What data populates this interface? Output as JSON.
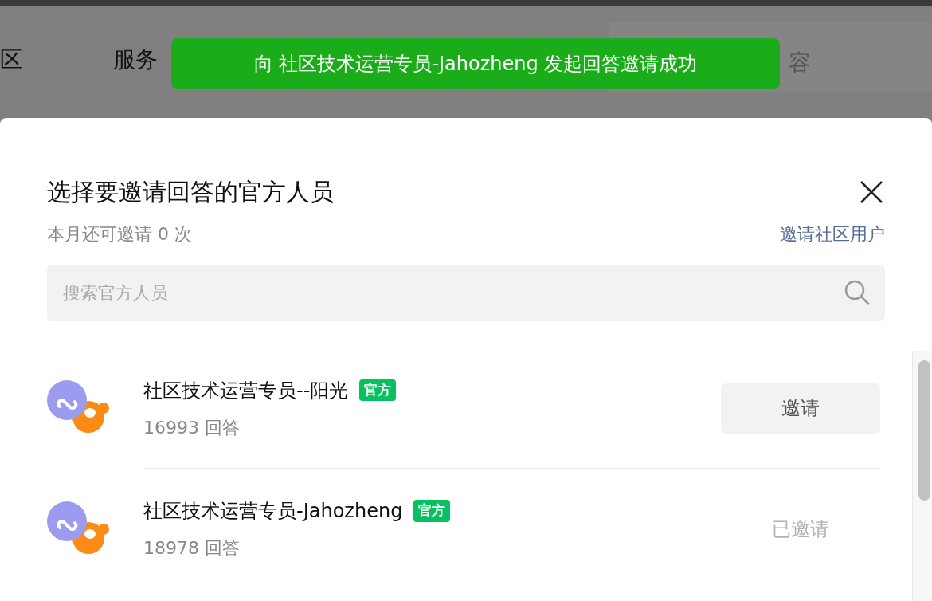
{
  "background_nav": [
    "区",
    "服务",
    "容"
  ],
  "toast": {
    "message": "向 社区技术运营专员-Jahozheng 发起回答邀请成功"
  },
  "dialog": {
    "title": "选择要邀请回答的官方人员",
    "quota": "本月还可邀请 0 次",
    "community_link": "邀请社区用户"
  },
  "search": {
    "placeholder": "搜索官方人员"
  },
  "people": [
    {
      "name": "社区技术运营专员--阳光",
      "badge": "官方",
      "answers": "16993 回答",
      "invited": false,
      "action": "邀请"
    },
    {
      "name": "社区技术运营专员-Jahozheng",
      "badge": "官方",
      "answers": "18978 回答",
      "invited": true,
      "action": "已邀请"
    }
  ]
}
